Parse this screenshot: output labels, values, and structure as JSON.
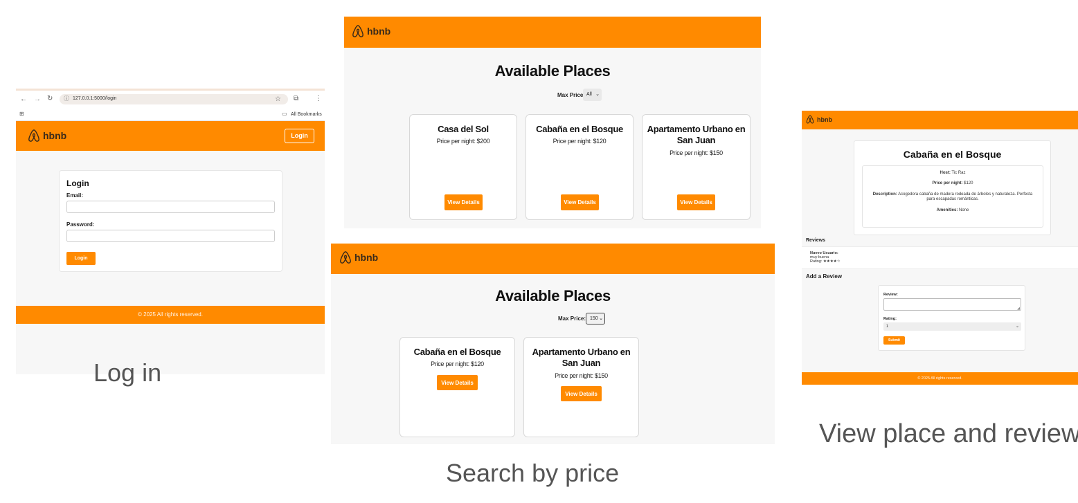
{
  "captions": {
    "login": "Log in",
    "search": "Search by price",
    "view": "View place and review"
  },
  "brand": {
    "name": "hbnb",
    "color": "#ff8a00",
    "logo_icon": "airbnb-logo-icon"
  },
  "login_screen": {
    "browser": {
      "url": "127.0.0.1:5000/login",
      "bookmarks_label": "All Bookmarks"
    },
    "header_login_button": "Login",
    "form": {
      "title": "Login",
      "email_label": "Email:",
      "email_value": "",
      "password_label": "Password:",
      "password_value": "",
      "submit_label": "Login"
    },
    "footer": "© 2025 All rights reserved."
  },
  "places_all": {
    "heading": "Available Places",
    "filter_label": "Max Price:",
    "filter_value": "All",
    "places": [
      {
        "name": "Casa del Sol",
        "price": "Price per night: $200",
        "button": "View Details"
      },
      {
        "name": "Cabaña en el Bosque",
        "price": "Price per night: $120",
        "button": "View Details"
      },
      {
        "name": "Apartamento Urbano en San Juan",
        "price": "Price per night: $150",
        "button": "View Details"
      }
    ]
  },
  "places_filtered": {
    "heading": "Available Places",
    "filter_label": "Max Price:",
    "filter_value": "150",
    "places": [
      {
        "name": "Cabaña en el Bosque",
        "price": "Price per night: $120",
        "button": "View Details"
      },
      {
        "name": "Apartamento Urbano en San Juan",
        "price": "Price per night: $150",
        "button": "View Details"
      }
    ]
  },
  "place_detail": {
    "title": "Cabaña en el Bosque",
    "host_label": "Host:",
    "host_value": "Tic Raz",
    "price_label": "Price per night:",
    "price_value": "$120",
    "description_label": "Description:",
    "description_value": "Acogedora cabaña de madera rodeada de árboles y naturaleza. Perfecta para escapadas románticas.",
    "amenities_label": "Amenities:",
    "amenities_value": "None",
    "reviews_heading": "Reviews",
    "review": {
      "user": "Nuevo Usuario:",
      "text": "muy buena",
      "rating_label": "Rating:",
      "stars": "★★★★☆"
    },
    "add_review_heading": "Add a Review",
    "review_label": "Review:",
    "review_value": "",
    "rating_label": "Rating:",
    "rating_value": "1",
    "submit_label": "Submit",
    "footer": "© 2025 All rights reserved."
  }
}
